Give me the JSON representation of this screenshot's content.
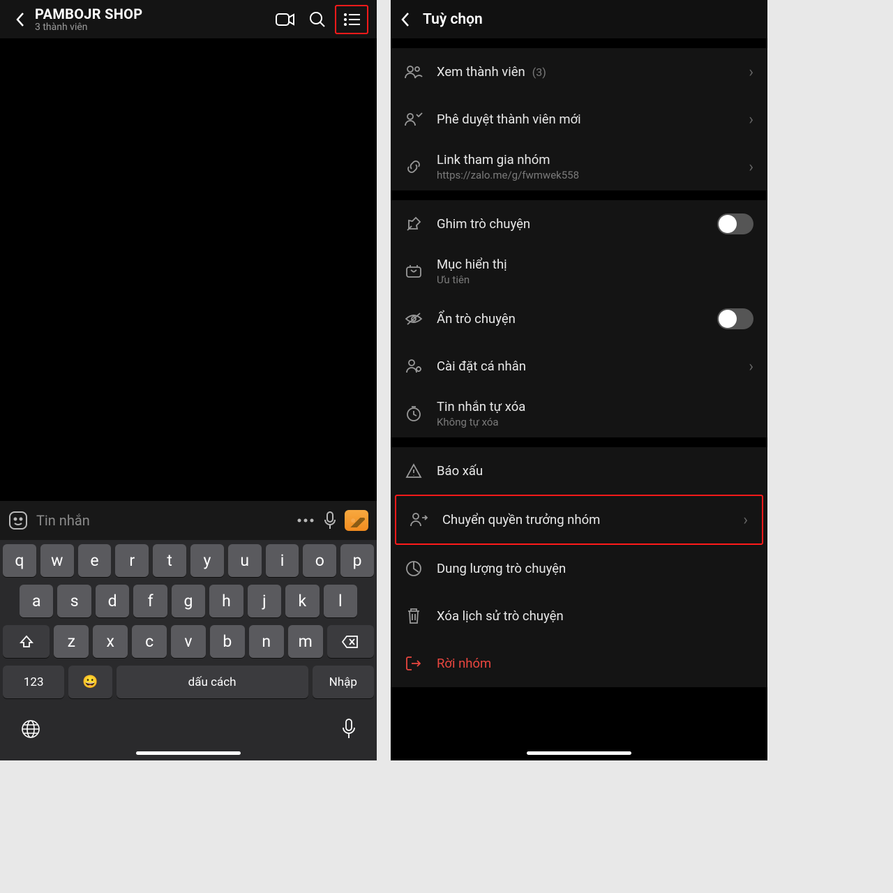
{
  "left": {
    "header": {
      "title": "PAMBOJR SHOP",
      "subtitle": "3 thành viên"
    },
    "input": {
      "placeholder": "Tin nhắn"
    },
    "keyboard": {
      "row1": [
        "q",
        "w",
        "e",
        "r",
        "t",
        "y",
        "u",
        "i",
        "o",
        "p"
      ],
      "row2": [
        "a",
        "s",
        "d",
        "f",
        "g",
        "h",
        "j",
        "k",
        "l"
      ],
      "row3": [
        "z",
        "x",
        "c",
        "v",
        "b",
        "n",
        "m"
      ],
      "num_key": "123",
      "space": "dấu cách",
      "enter": "Nhập"
    }
  },
  "right": {
    "title": "Tuỳ chọn",
    "members": {
      "label": "Xem thành viên",
      "count": "(3)"
    },
    "approve": "Phê duyệt thành viên mới",
    "link": {
      "label": "Link tham gia nhóm",
      "url": "https://zalo.me/g/fwmwek558"
    },
    "pin": "Ghim trò chuyện",
    "display": {
      "label": "Mục hiển thị",
      "sub": "Ưu tiên"
    },
    "hide": "Ẩn trò chuyện",
    "personal": "Cài đặt cá nhân",
    "autodelete": {
      "label": "Tin nhắn tự xóa",
      "sub": "Không tự xóa"
    },
    "report": "Báo xấu",
    "transfer": "Chuyển quyền trưởng nhóm",
    "storage": "Dung lượng trò chuyện",
    "clear": "Xóa lịch sử trò chuyện",
    "leave": "Rời nhóm"
  }
}
